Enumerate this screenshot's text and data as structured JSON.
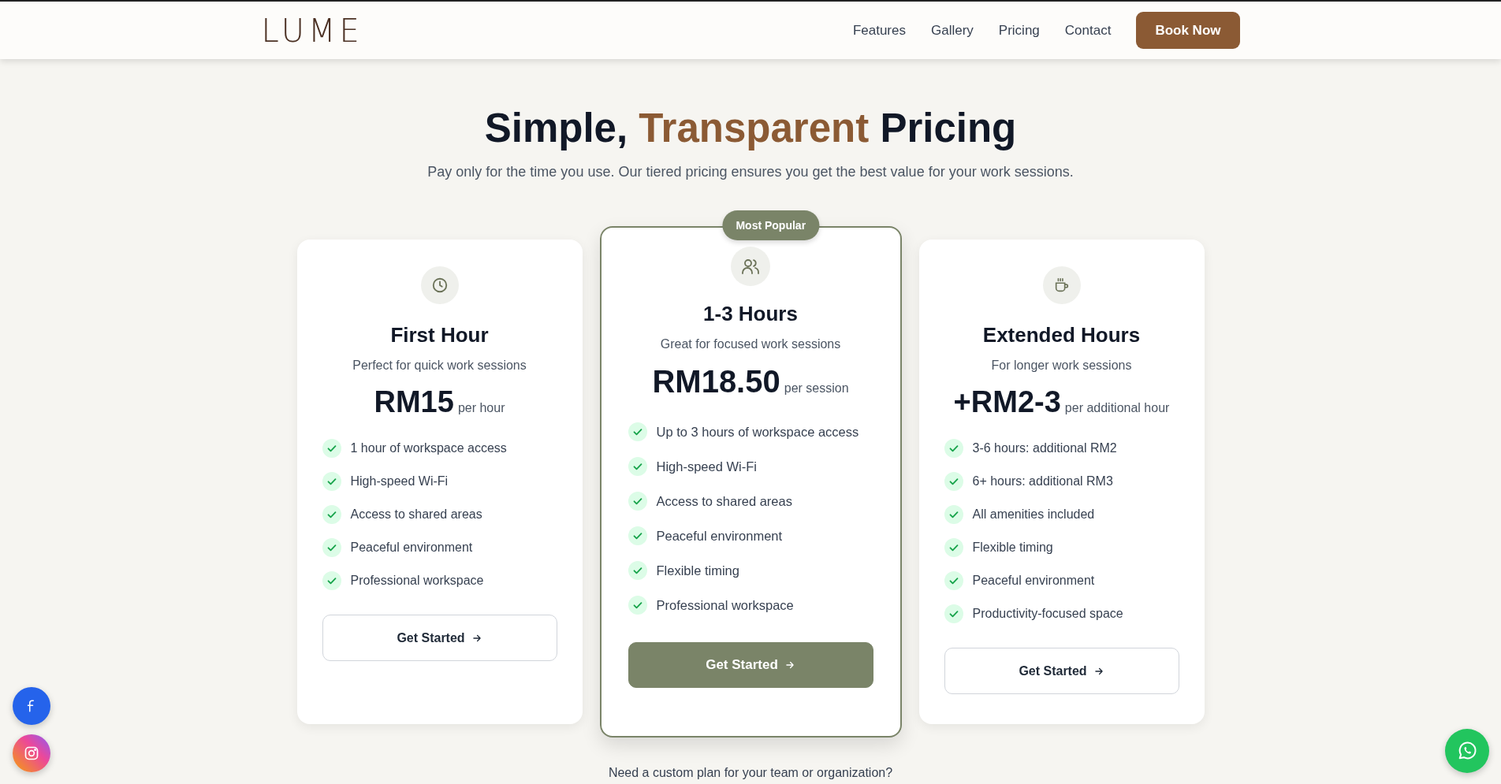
{
  "header": {
    "logo": "LUME",
    "nav": [
      "Features",
      "Gallery",
      "Pricing",
      "Contact"
    ],
    "cta": "Book Now"
  },
  "heading": {
    "parts": [
      {
        "text": "Simple,",
        "accent": false
      },
      {
        "text": "Transparent",
        "accent": true
      },
      {
        "text": "Pricing",
        "accent": false
      }
    ],
    "subtitle": "Pay only for the time you use. Our tiered pricing ensures you get the best value for your work sessions."
  },
  "plans": [
    {
      "title": "First Hour",
      "description": "Perfect for quick work sessions",
      "price": "RM15",
      "unit": "per hour",
      "featured": false,
      "features": [
        "1 hour of workspace access",
        "High-speed Wi-Fi",
        "Access to shared areas",
        "Peaceful environment",
        "Professional workspace"
      ],
      "button": "Get Started"
    },
    {
      "title": "1-3 Hours",
      "description": "Great for focused work sessions",
      "price": "RM18.50",
      "unit": "per session",
      "featured": true,
      "badge": "Most Popular",
      "features": [
        "Up to 3 hours of workspace access",
        "High-speed Wi-Fi",
        "Access to shared areas",
        "Peaceful environment",
        "Flexible timing",
        "Professional workspace"
      ],
      "button": "Get Started"
    },
    {
      "title": "Extended Hours",
      "description": "For longer work sessions",
      "price": "+RM2-3",
      "unit": "per additional hour",
      "featured": false,
      "features": [
        "3-6 hours: additional RM2",
        "6+ hours: additional RM3",
        "All amenities included",
        "Flexible timing",
        "Peaceful environment",
        "Productivity-focused space"
      ],
      "button": "Get Started"
    }
  ],
  "footnote": "Need a custom plan for your team or organization?"
}
